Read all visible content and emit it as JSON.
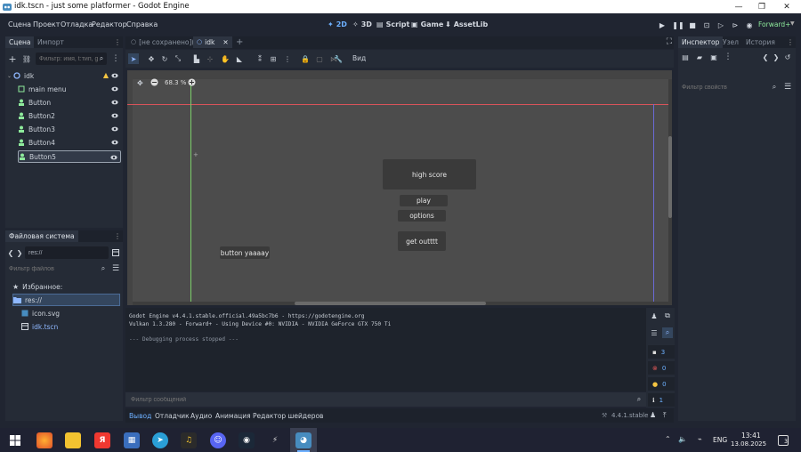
{
  "window": {
    "title": "idk.tscn - just some platformer - Godot Engine"
  },
  "menubar": {
    "items": [
      "Сцена",
      "Проект",
      "Отладка",
      "Редактор",
      "Справка"
    ],
    "modes": {
      "m2d": "2D",
      "m3d": "3D",
      "script": "Script",
      "game": "Game",
      "assetlib": "AssetLib"
    },
    "renderer": "Forward+"
  },
  "scene_dock": {
    "tabs": [
      "Сцена",
      "Импорт"
    ],
    "filter_placeholder": "Фильтр: имя, t:тип, g",
    "nodes": [
      {
        "name": "idk",
        "type": "root"
      },
      {
        "name": "main menu",
        "type": "control"
      },
      {
        "name": "Button",
        "type": "button"
      },
      {
        "name": "Button2",
        "type": "button"
      },
      {
        "name": "Button3",
        "type": "button"
      },
      {
        "name": "Button4",
        "type": "button"
      },
      {
        "name": "Button5",
        "type": "button",
        "selected": true
      }
    ]
  },
  "filesystem_dock": {
    "title": "Файловая система",
    "path": "res://",
    "filter_placeholder": "Фильтр файлов",
    "favorites": "Избранное:",
    "tree": [
      "res://",
      "icon.svg",
      "idk.tscn"
    ]
  },
  "editor_tabs": [
    "[не сохранено](*)",
    "idk"
  ],
  "toolbar": {
    "view_label": "Вид"
  },
  "viewport": {
    "zoom": "68.3 %",
    "buttons": {
      "high_score": "high score",
      "play": "play",
      "options": "options",
      "get_out": "get outttt",
      "yaaaay": "button yaaaay"
    }
  },
  "output": {
    "lines": [
      "Godot Engine v4.4.1.stable.official.49a5bc7b6 - https://godotengine.org",
      "Vulkan 1.3.280 - Forward+ - Using Device #0: NVIDIA - NVIDIA GeForce GTX 750 Ti",
      "--- Debugging process stopped ---"
    ],
    "filter_placeholder": "Фильтр сообщений",
    "counts": {
      "log": "3",
      "errors": "0",
      "warnings": "0",
      "info": "1"
    }
  },
  "bottom_tabs": [
    "Вывод",
    "Отладчик",
    "Аудио",
    "Анимация",
    "Редактор шейдеров"
  ],
  "version": "4.4.1.stable",
  "inspector": {
    "tabs": [
      "Инспектор",
      "Узел",
      "История"
    ],
    "filter_placeholder": "Фильтр свойств"
  },
  "taskbar": {
    "time": "13:41",
    "date": "13.08.2025",
    "lang": "ENG",
    "notifications": "3"
  },
  "colors": {
    "accent": "#6db0ff",
    "button_icon": "#8eeb9c",
    "root_icon": "#8fb8ff"
  }
}
